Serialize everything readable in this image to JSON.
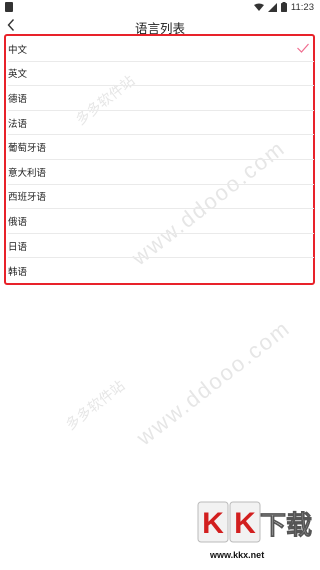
{
  "status_bar": {
    "time": "11:23"
  },
  "header": {
    "title": "语言列表"
  },
  "languages": [
    {
      "label": "中文",
      "selected": true
    },
    {
      "label": "英文",
      "selected": false
    },
    {
      "label": "德语",
      "selected": false
    },
    {
      "label": "法语",
      "selected": false
    },
    {
      "label": "葡萄牙语",
      "selected": false
    },
    {
      "label": "意大利语",
      "selected": false
    },
    {
      "label": "西班牙语",
      "selected": false
    },
    {
      "label": "俄语",
      "selected": false
    },
    {
      "label": "日语",
      "selected": false
    },
    {
      "label": "韩语",
      "selected": false
    }
  ],
  "watermarks": {
    "brand_cn": "多多软件站",
    "url": "www.ddooo.com",
    "logo_text": "KK下载",
    "logo_domain": "www.kkx.net"
  },
  "colors": {
    "highlight_frame": "#e8222a",
    "check_mark": "#f06d8f"
  }
}
